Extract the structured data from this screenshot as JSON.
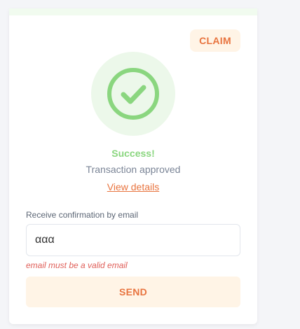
{
  "header": {
    "claim_label": "CLAIM"
  },
  "status": {
    "icon": "check-circle-icon",
    "title": "Success!",
    "subtitle": "Transaction approved",
    "details_link": "View details"
  },
  "email_form": {
    "label": "Receive confirmation by email",
    "value": "ααα",
    "error": "email must be a valid email",
    "send_label": "SEND"
  },
  "colors": {
    "accent": "#e8743f",
    "accent_bg": "#fff4e6",
    "success": "#8ad67f",
    "success_bg": "#ecf8ea",
    "error": "#e0605a"
  }
}
